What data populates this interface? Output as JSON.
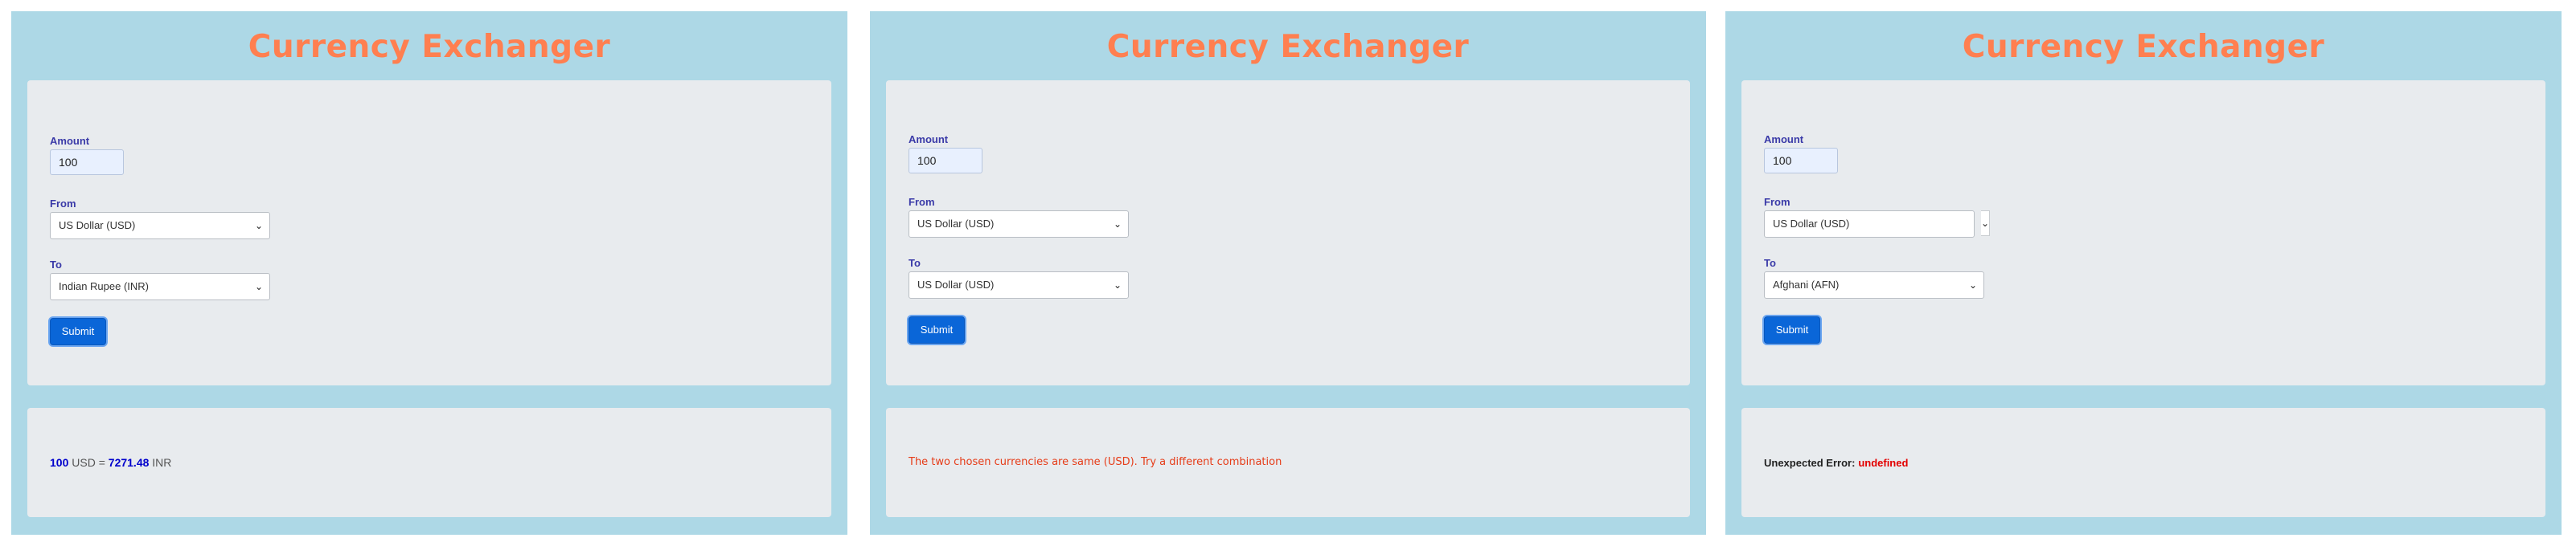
{
  "panels": [
    {
      "title": "Currency Exchanger",
      "amount_label": "Amount",
      "amount_value": "100",
      "from_label": "From",
      "from_selected": "US Dollar (USD)",
      "to_label": "To",
      "to_selected": "Indian Rupee (INR)",
      "submit_label": "Submit",
      "result": {
        "amount": "100",
        "from_code": "USD",
        "equals": "=",
        "converted": "7271.48",
        "to_code": "INR"
      }
    },
    {
      "title": "Currency Exchanger",
      "amount_label": "Amount",
      "amount_value": "100",
      "from_label": "From",
      "from_selected": "US Dollar (USD)",
      "to_label": "To",
      "to_selected": "US Dollar (USD)",
      "submit_label": "Submit",
      "message": "The two chosen currencies are same (USD). Try a different combination"
    },
    {
      "title": "Currency Exchanger",
      "amount_label": "Amount",
      "amount_value": "100",
      "from_label": "From",
      "from_selected": "US Dollar (USD)",
      "to_label": "To",
      "to_selected": "Afghani (AFN)",
      "submit_label": "Submit",
      "error_label": "Unexpected Error:",
      "error_value": "undefined"
    }
  ],
  "icons": {
    "chevron": "chevron-down-icon",
    "glyph": "⌄"
  },
  "colors": {
    "panel_bg": "#add8e6",
    "card_bg": "#e8ebee",
    "title": "#ff7f50",
    "label": "#3a3aa8",
    "button": "#0a66d8",
    "result_number": "#0000cc",
    "warning": "#e63c18",
    "error": "#e30000"
  }
}
